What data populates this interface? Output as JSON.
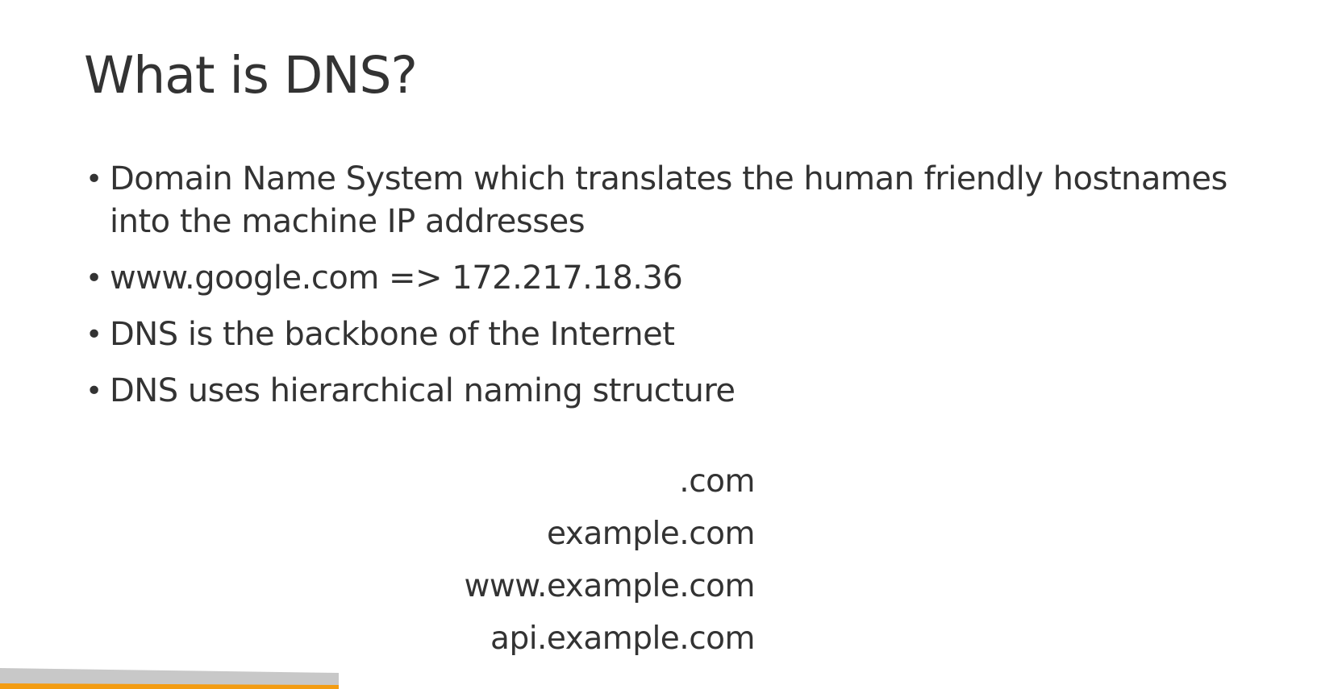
{
  "slide": {
    "title": "What is DNS?",
    "bullets": [
      "Domain Name System which translates the human friendly hostnames into the machine IP addresses",
      "www.google.com => 172.217.18.36",
      "DNS is the backbone of the Internet",
      "DNS uses hierarchical naming structure"
    ],
    "hierarchy": [
      ".com",
      "example.com",
      "www.example.com",
      "api.example.com"
    ]
  },
  "colors": {
    "text": "#333333",
    "accent_orange": "#f39c12",
    "footer_gray": "#c8c8c8"
  }
}
